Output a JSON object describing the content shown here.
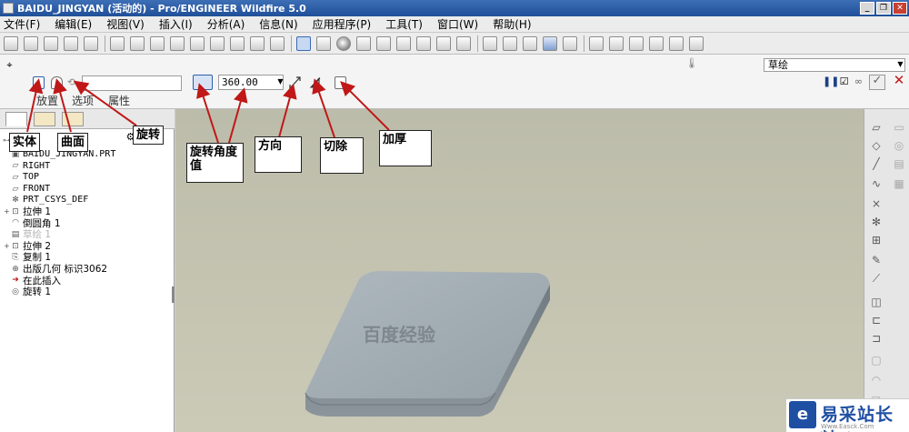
{
  "window": {
    "title": "BAIDU_JINGYAN (活动的) - Pro/ENGINEER Wildfire 5.0"
  },
  "menu": [
    "文件(F)",
    "编辑(E)",
    "视图(V)",
    "插入(I)",
    "分析(A)",
    "信息(N)",
    "应用程序(P)",
    "工具(T)",
    "窗口(W)",
    "帮助(H)"
  ],
  "dashboard": {
    "angle_value": "360.00",
    "tabs": [
      "放置",
      "选项",
      "属性"
    ],
    "filter_select": "草绘"
  },
  "model_tree": {
    "items": [
      {
        "label": "BAIDU_JINGYAN.PRT",
        "icon": "part-icon"
      },
      {
        "label": "RIGHT",
        "icon": "datum-plane-icon"
      },
      {
        "label": "TOP",
        "icon": "datum-plane-icon"
      },
      {
        "label": "FRONT",
        "icon": "datum-plane-icon"
      },
      {
        "label": "PRT_CSYS_DEF",
        "icon": "csys-icon"
      },
      {
        "label": "拉伸 1",
        "icon": "extrude-icon",
        "expandable": true
      },
      {
        "label": "倒圆角 1",
        "icon": "round-icon"
      },
      {
        "label": "草绘 1",
        "icon": "sketch-icon",
        "dim": true
      },
      {
        "label": "拉伸 2",
        "icon": "extrude-icon",
        "expandable": true
      },
      {
        "label": "复制 1",
        "icon": "copy-icon"
      },
      {
        "label": "出版几何 标识3062",
        "icon": "publish-geom-icon"
      },
      {
        "label": "在此插入",
        "icon": "insert-here-icon"
      },
      {
        "label": "旋转 1",
        "icon": "revolve-icon"
      }
    ]
  },
  "annotations": [
    {
      "label": "实体"
    },
    {
      "label": "曲面"
    },
    {
      "label": "旋转"
    },
    {
      "label": "旋转角度值"
    },
    {
      "label": "方向"
    },
    {
      "label": "切除"
    },
    {
      "label": "加厚"
    }
  ],
  "model_engraving": "百度经验",
  "watermark": {
    "brand": "易采站长站",
    "url": "Www.Easck.Com  Webmaster"
  },
  "colors": {
    "title_bar": "#1f4f98",
    "arrow": "#c01818",
    "viewport": "#c4c3b0",
    "model_top": "#a9b3b9"
  }
}
